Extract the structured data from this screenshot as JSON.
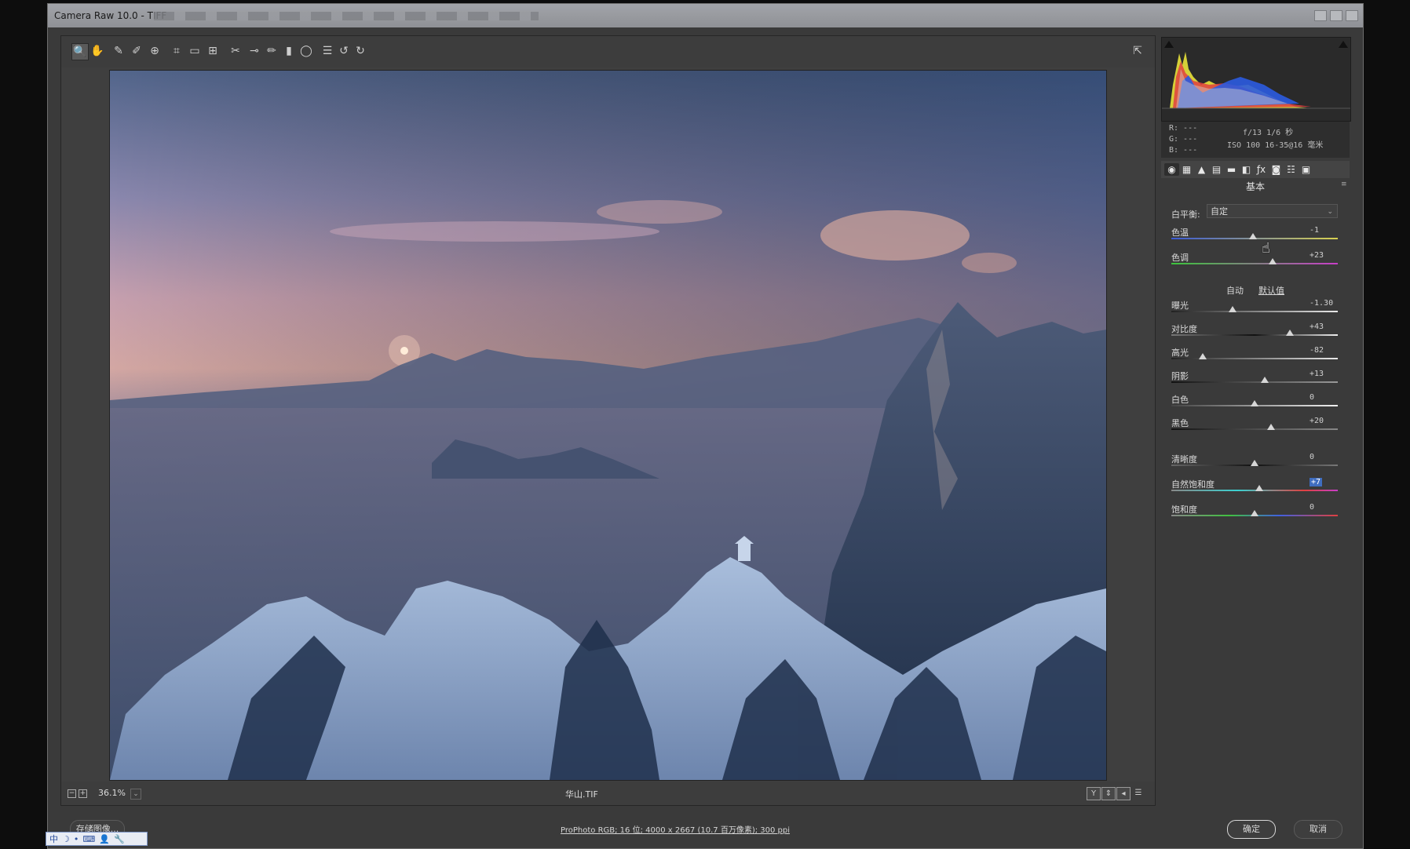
{
  "window": {
    "title": "Camera Raw 10.0 - TIFF"
  },
  "toolbar": {
    "tools": [
      {
        "name": "zoom-tool-icon",
        "glyph": "🔍",
        "active": true
      },
      {
        "name": "hand-tool-icon",
        "glyph": "✋"
      },
      {
        "name": "white-balance-tool-icon",
        "glyph": "✎"
      },
      {
        "name": "color-sampler-tool-icon",
        "glyph": "✐"
      },
      {
        "name": "targeted-adjustment-tool-icon",
        "glyph": "⊕"
      },
      {
        "name": "crop-tool-icon",
        "glyph": "⌗"
      },
      {
        "name": "straighten-tool-icon",
        "glyph": "▭"
      },
      {
        "name": "transform-tool-icon",
        "glyph": "⊞"
      },
      {
        "name": "spot-removal-tool-icon",
        "glyph": "✂"
      },
      {
        "name": "red-eye-removal-tool-icon",
        "glyph": "⊸"
      },
      {
        "name": "adjustment-brush-icon",
        "glyph": "✏"
      },
      {
        "name": "graduated-filter-icon",
        "glyph": "▮"
      },
      {
        "name": "radial-filter-icon",
        "glyph": "◯"
      },
      {
        "name": "preferences-icon",
        "glyph": "☰"
      },
      {
        "name": "rotate-left-icon",
        "glyph": "↺"
      },
      {
        "name": "rotate-right-icon",
        "glyph": "↻"
      }
    ],
    "fullscreen_glyph": "⇱"
  },
  "status": {
    "zoom": "36.1%",
    "filename": "华山.TIF"
  },
  "histogram": {
    "rgb_readout": [
      "R: ---",
      "G: ---",
      "B: ---"
    ],
    "exif": [
      "f/13  1/6 秒",
      "ISO 100  16-35@16 毫米"
    ]
  },
  "panel": {
    "title": "基本",
    "tabs": [
      "◉",
      "▦",
      "▲",
      "▤",
      "▬",
      "◧",
      "ƒx",
      "◙",
      "☷",
      "▣"
    ],
    "white_balance": {
      "label": "白平衡:",
      "value": "自定"
    },
    "auto_label": "自动",
    "default_label": "默认值",
    "sliders": [
      {
        "name": "temperature",
        "label": "色温",
        "value": "-1",
        "pos": 0.49,
        "track": "linear-gradient(90deg,#3b5bd6,#d8d150)"
      },
      {
        "name": "tint",
        "label": "色调",
        "value": "+23",
        "pos": 0.61,
        "track": "linear-gradient(90deg,#3cc43c,#c83ec8)"
      },
      {
        "name": "exposure",
        "label": "曝光",
        "value": "-1.30",
        "pos": 0.37,
        "track": "linear-gradient(90deg,#222,#e8e8e8)"
      },
      {
        "name": "contrast",
        "label": "对比度",
        "value": "+43",
        "pos": 0.71,
        "track": "linear-gradient(90deg,#777,#111 50%,#eee)"
      },
      {
        "name": "highlights",
        "label": "高光",
        "value": "-82",
        "pos": 0.19,
        "track": "linear-gradient(90deg,#222,#e8e8e8)"
      },
      {
        "name": "shadows",
        "label": "阴影",
        "value": "+13",
        "pos": 0.56,
        "track": "linear-gradient(90deg,#111,#999)"
      },
      {
        "name": "whites",
        "label": "白色",
        "value": "0",
        "pos": 0.5,
        "track": "linear-gradient(90deg,#444,#f0f0f0)"
      },
      {
        "name": "blacks",
        "label": "黑色",
        "value": "+20",
        "pos": 0.6,
        "track": "linear-gradient(90deg,#111,#888)"
      },
      {
        "name": "clarity",
        "label": "清晰度",
        "value": "0",
        "pos": 0.5,
        "track": "linear-gradient(90deg,#666,#111 50%,#777)"
      },
      {
        "name": "vibrance",
        "label": "自然饱和度",
        "value": "+7",
        "pos": 0.53,
        "selected": true,
        "track": "linear-gradient(90deg,#888,#3ad0d0 40%,#e04040 80%,#c83ec8)"
      },
      {
        "name": "saturation",
        "label": "饱和度",
        "value": "0",
        "pos": 0.5,
        "track": "linear-gradient(90deg,#888,#40c040 35%,#4060e0 65%,#e04040)"
      }
    ]
  },
  "bottom": {
    "save_label": "存储图像...",
    "workflow": "ProPhoto RGB; 16 位; 4000 x 2667 (10.7 百万像素); 300 ppi",
    "ok_label": "确定",
    "cancel_label": "取消"
  },
  "ime": [
    "中",
    "☽",
    "•",
    "⌨",
    "👤",
    "🔧"
  ]
}
